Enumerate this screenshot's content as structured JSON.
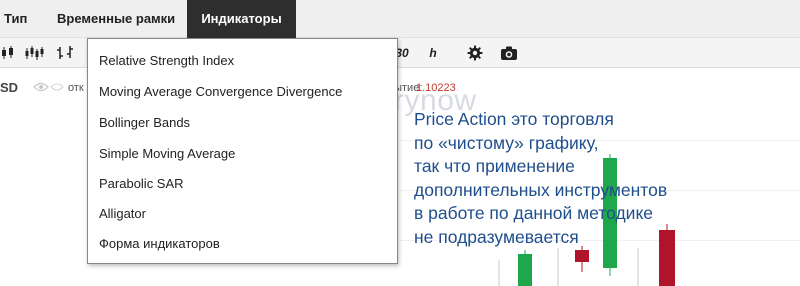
{
  "menu": {
    "type_label": "Тип",
    "timeframes_label": "Временные рамки",
    "indicators_label": "Индикаторы"
  },
  "toolbar": {
    "candles_icon": "candlestick-icon",
    "bars_icon": "ohlc-bars-icon",
    "period_label": "30",
    "hour_label": "h",
    "settings_icon": "gear-icon",
    "screenshot_icon": "camera-icon"
  },
  "info": {
    "symbol": "SD",
    "open_label": "отк",
    "close_label": "рытие:",
    "close_value": "1.10223"
  },
  "watermark": {
    "text": "Binarynow"
  },
  "indicators_menu": {
    "items": [
      "Relative Strength Index",
      "Moving Average Convergence Divergence",
      "Bollinger Bands",
      "Simple Moving Average",
      "Parabolic SAR",
      "Alligator",
      "Форма индикаторов"
    ]
  },
  "annotation": {
    "lines": [
      "Price Action это торговля",
      "по «чистому» графику,",
      "так что применение",
      "дополнительных инструментов",
      "в работе по данной методике",
      "не подразумевается"
    ]
  },
  "colors": {
    "bull": "#1ea84b",
    "bear": "#b0142a",
    "annotation_text": "#1f4e8c",
    "active_menu_bg": "#2e2e2e",
    "close_value": "#c0392b"
  }
}
